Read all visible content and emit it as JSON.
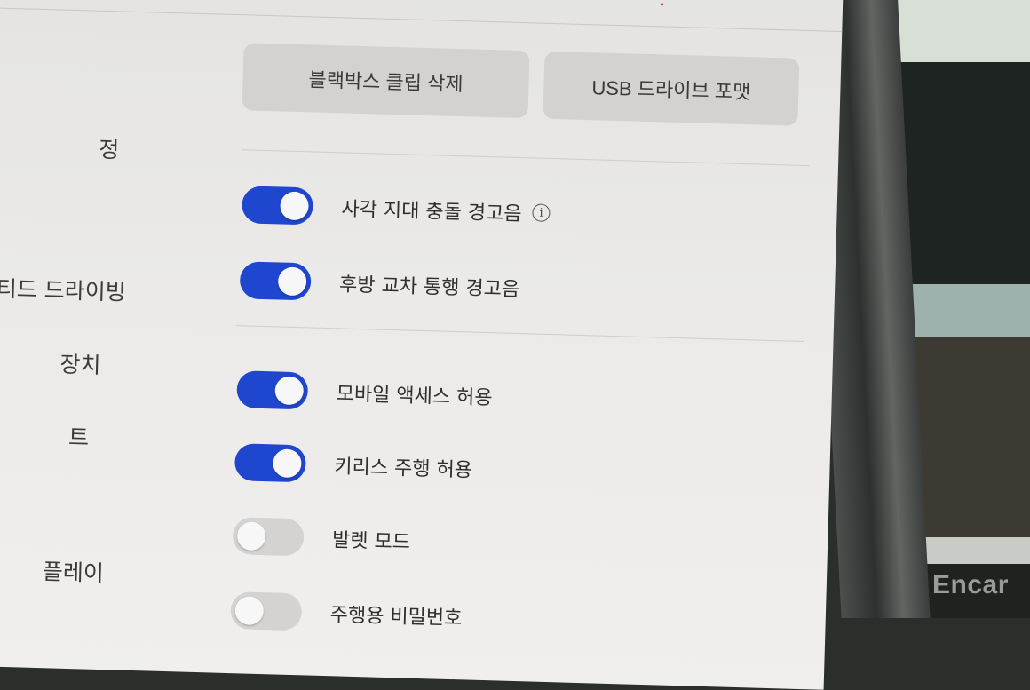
{
  "watermark": "Encar",
  "sidebar": {
    "items": [
      {
        "label": "정"
      },
      {
        "label": "티드 드라이빙"
      },
      {
        "label": "장치"
      },
      {
        "label": "트"
      },
      {
        "label": "플레이"
      }
    ]
  },
  "actions": {
    "delete_clips_label": "블랙박스 클립 삭제",
    "format_usb_label": "USB 드라이브 포맷"
  },
  "toggles": [
    {
      "label": "사각 지대 충돌 경고음",
      "state": "on",
      "has_info": true
    },
    {
      "label": "후방 교차 통행 경고음",
      "state": "on"
    },
    {
      "label": "모바일 액세스 허용",
      "state": "on"
    },
    {
      "label": "키리스 주행 허용",
      "state": "on"
    },
    {
      "label": "발렛 모드",
      "state": "off"
    },
    {
      "label": "주행용 비밀번호",
      "state": "off"
    }
  ],
  "info_glyph": "i",
  "colors": {
    "toggle_on": "#1f46cf",
    "toggle_off": "#d4d3d2"
  }
}
